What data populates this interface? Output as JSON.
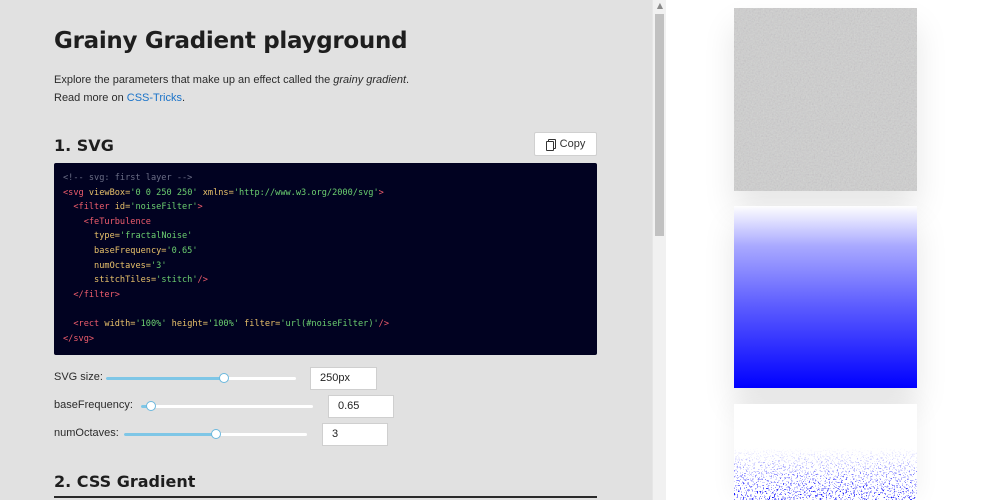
{
  "page": {
    "title": "Grainy Gradient playground",
    "intro_line1_a": "Explore the parameters that make up an effect called the ",
    "intro_line1_em": "grainy gradient",
    "intro_line1_b": ".",
    "intro_line2_a": "Read more on ",
    "intro_link": "CSS-Tricks",
    "intro_line2_b": "."
  },
  "section_svg": {
    "heading": "1. SVG",
    "copy_label": "Copy",
    "copy_icon": "copy-icon",
    "code_lines": [
      [
        {
          "c": "c-comment",
          "t": "<!-- svg: first layer -->"
        }
      ],
      [
        {
          "c": "c-tag",
          "t": "<svg"
        },
        {
          "c": "c-attr",
          "t": " viewBox="
        },
        {
          "c": "c-str",
          "t": "'0 0 250 250'"
        },
        {
          "c": "c-attr",
          "t": " xmlns="
        },
        {
          "c": "c-str",
          "t": "'http://www.w3.org/2000/svg'"
        },
        {
          "c": "c-tag",
          "t": ">"
        }
      ],
      [
        {
          "c": "c-punct",
          "t": "  "
        },
        {
          "c": "c-tag",
          "t": "<filter"
        },
        {
          "c": "c-attr",
          "t": " id="
        },
        {
          "c": "c-str",
          "t": "'noiseFilter'"
        },
        {
          "c": "c-tag",
          "t": ">"
        }
      ],
      [
        {
          "c": "c-punct",
          "t": "    "
        },
        {
          "c": "c-tag",
          "t": "<feTurbulence"
        }
      ],
      [
        {
          "c": "c-punct",
          "t": "      "
        },
        {
          "c": "c-attr",
          "t": "type="
        },
        {
          "c": "c-str",
          "t": "'fractalNoise'"
        }
      ],
      [
        {
          "c": "c-punct",
          "t": "      "
        },
        {
          "c": "c-attr",
          "t": "baseFrequency="
        },
        {
          "c": "c-str",
          "t": "'0.65'"
        }
      ],
      [
        {
          "c": "c-punct",
          "t": "      "
        },
        {
          "c": "c-attr",
          "t": "numOctaves="
        },
        {
          "c": "c-str",
          "t": "'3'"
        }
      ],
      [
        {
          "c": "c-punct",
          "t": "      "
        },
        {
          "c": "c-attr",
          "t": "stitchTiles="
        },
        {
          "c": "c-str",
          "t": "'stitch'"
        },
        {
          "c": "c-tag",
          "t": "/>"
        }
      ],
      [
        {
          "c": "c-punct",
          "t": "  "
        },
        {
          "c": "c-tag",
          "t": "</filter>"
        }
      ],
      [
        {
          "c": "c-punct",
          "t": " "
        }
      ],
      [
        {
          "c": "c-punct",
          "t": "  "
        },
        {
          "c": "c-tag",
          "t": "<rect"
        },
        {
          "c": "c-attr",
          "t": " width="
        },
        {
          "c": "c-str",
          "t": "'100%'"
        },
        {
          "c": "c-attr",
          "t": " height="
        },
        {
          "c": "c-str",
          "t": "'100%'"
        },
        {
          "c": "c-attr",
          "t": " filter="
        },
        {
          "c": "c-str",
          "t": "'url(#noiseFilter)'"
        },
        {
          "c": "c-tag",
          "t": "/>"
        }
      ],
      [
        {
          "c": "c-tag",
          "t": "</svg>"
        }
      ]
    ]
  },
  "controls": {
    "svg_size": {
      "label": "SVG size:",
      "value": "250px",
      "level": 0.62
    },
    "base_frequency": {
      "label": "baseFrequency:",
      "value": "0.65",
      "level": 0.06
    },
    "num_octaves": {
      "label": "numOctaves:",
      "value": "3",
      "level": 0.5
    }
  },
  "section_css": {
    "heading": "2. CSS Gradient"
  },
  "colors": {
    "accent_link": "#1a73c9",
    "slider_fill": "#7ec6e6",
    "code_bg": "#010221",
    "gradient_blue": "#0000ff",
    "panel_bg": "#e1e1e1"
  }
}
